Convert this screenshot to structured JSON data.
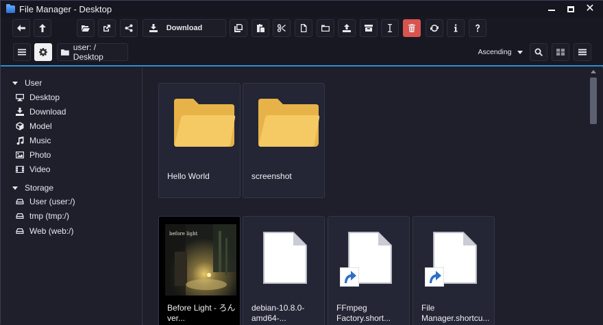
{
  "window": {
    "title": "File Manager - Desktop",
    "controls": {
      "minimize": "minimize",
      "maximize": "maximize",
      "close": "✕"
    }
  },
  "toolbar": {
    "download_label": "Download",
    "buttons": [
      "arrow-left-icon",
      "arrow-up-icon",
      "folder-open-icon",
      "external-link-icon",
      "share-icon",
      "download-icon",
      "copy-icon",
      "paste-icon",
      "scissors-icon",
      "new-file-icon",
      "new-folder-icon",
      "upload-icon",
      "archive-icon",
      "rename-cursor-icon",
      "trash-icon",
      "refresh-icon",
      "info-icon",
      "help-icon"
    ],
    "delete_color": "#d9534f"
  },
  "navbar": {
    "breadcrumb": "user: / Desktop",
    "sort_label": "Ascending"
  },
  "sidebar": {
    "groups": [
      {
        "label": "User",
        "items": [
          {
            "label": "Desktop",
            "icon": "desktop-icon"
          },
          {
            "label": "Download",
            "icon": "download-icon"
          },
          {
            "label": "Model",
            "icon": "cube-icon"
          },
          {
            "label": "Music",
            "icon": "music-icon"
          },
          {
            "label": "Photo",
            "icon": "image-icon"
          },
          {
            "label": "Video",
            "icon": "film-icon"
          }
        ]
      },
      {
        "label": "Storage",
        "items": [
          {
            "label": "User (user:/)",
            "icon": "drive-icon"
          },
          {
            "label": "tmp (tmp:/)",
            "icon": "drive-icon"
          },
          {
            "label": "Web (web:/)",
            "icon": "drive-icon"
          }
        ]
      }
    ]
  },
  "files": [
    {
      "name": "Hello World",
      "type": "folder"
    },
    {
      "name": "screenshot",
      "type": "folder"
    },
    {
      "name_line1": "Before Light - ろん",
      "name_line2": "ver...",
      "type": "image",
      "thumbnail_text": "before light"
    },
    {
      "name_line1": "debian-10.8.0-",
      "name_line2": "amd64-...",
      "type": "file"
    },
    {
      "name_line1": "FFmpeg",
      "name_line2": "Factory.short...",
      "type": "shortcut"
    },
    {
      "name_line1": "File",
      "name_line2": "Manager.shortcu...",
      "type": "shortcut"
    }
  ],
  "colors": {
    "accent": "#2f8fcf",
    "folder": "#f2c35b",
    "background": "#1e1f2b"
  }
}
